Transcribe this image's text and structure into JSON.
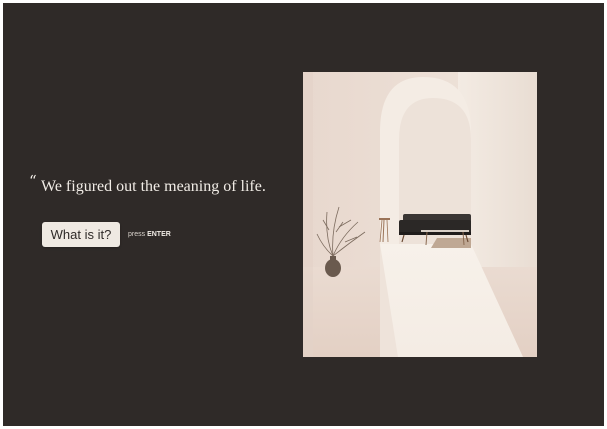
{
  "question": {
    "quote_mark": "“",
    "text": "We figured out the meaning of life."
  },
  "cta": {
    "button_label": "What is it?",
    "hint_prefix": "press",
    "hint_key": "ENTER"
  },
  "image": {
    "alt": "Minimal interior with an arched doorway, a dark sofa, a small side table and a vase with dried branches"
  },
  "colors": {
    "background": "#2f2a28",
    "text": "#f1ece6",
    "button_bg": "#efe9e2",
    "button_text": "#2f2a28"
  }
}
